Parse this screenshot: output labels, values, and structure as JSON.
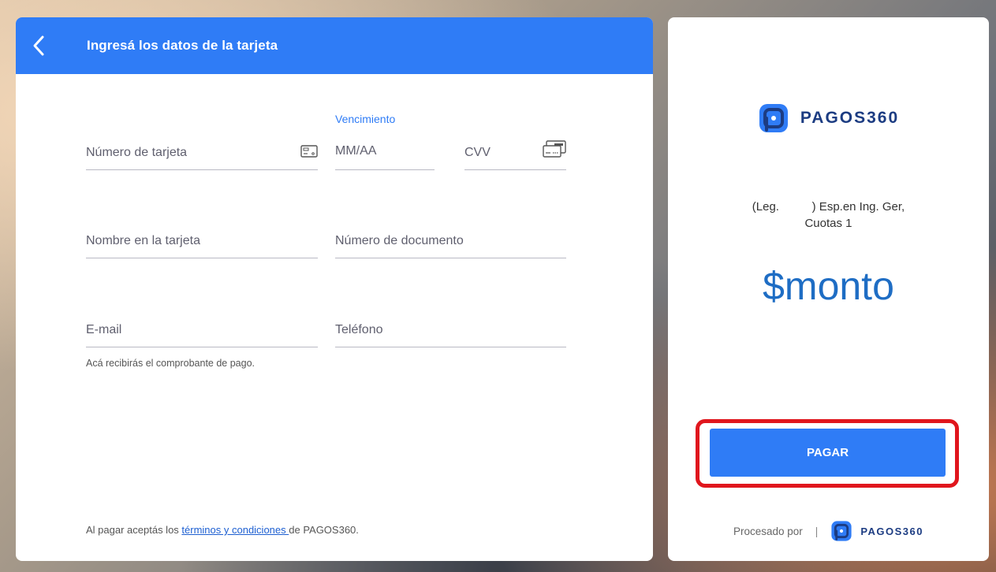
{
  "header": {
    "title": "Ingresá los datos de la tarjeta"
  },
  "form": {
    "card_number_placeholder": "Número de tarjeta",
    "expiry_label": "Vencimiento",
    "expiry_placeholder": "MM/AA",
    "cvv_placeholder": "CVV",
    "cardholder_placeholder": "Nombre en la tarjeta",
    "document_placeholder": "Número de documento",
    "email_placeholder": "E-mail",
    "email_help": "Acá recibirás el comprobante de pago.",
    "phone_placeholder": "Teléfono"
  },
  "footer": {
    "terms_prefix": "Al pagar aceptás los ",
    "terms_link": "términos y condiciones ",
    "terms_suffix": "de PAGOS360."
  },
  "summary": {
    "brand": "PAGOS360",
    "description_line1": "(Leg.          ) Esp.en Ing. Ger,",
    "description_line2": "Cuotas 1",
    "amount": "$monto",
    "pay_button": "PAGAR",
    "processed_by": "Procesado por",
    "separator": "|",
    "footer_brand": "PAGOS360"
  },
  "colors": {
    "primary": "#2f7cf6",
    "brand_dark": "#1c3c82",
    "amount": "#1e6dc4",
    "highlight": "#e0161d"
  },
  "icons": {
    "back": "chevron-left-icon",
    "card": "credit-card-icon",
    "cvv": "card-back-icon",
    "logo": "pagos360-logo-icon"
  }
}
